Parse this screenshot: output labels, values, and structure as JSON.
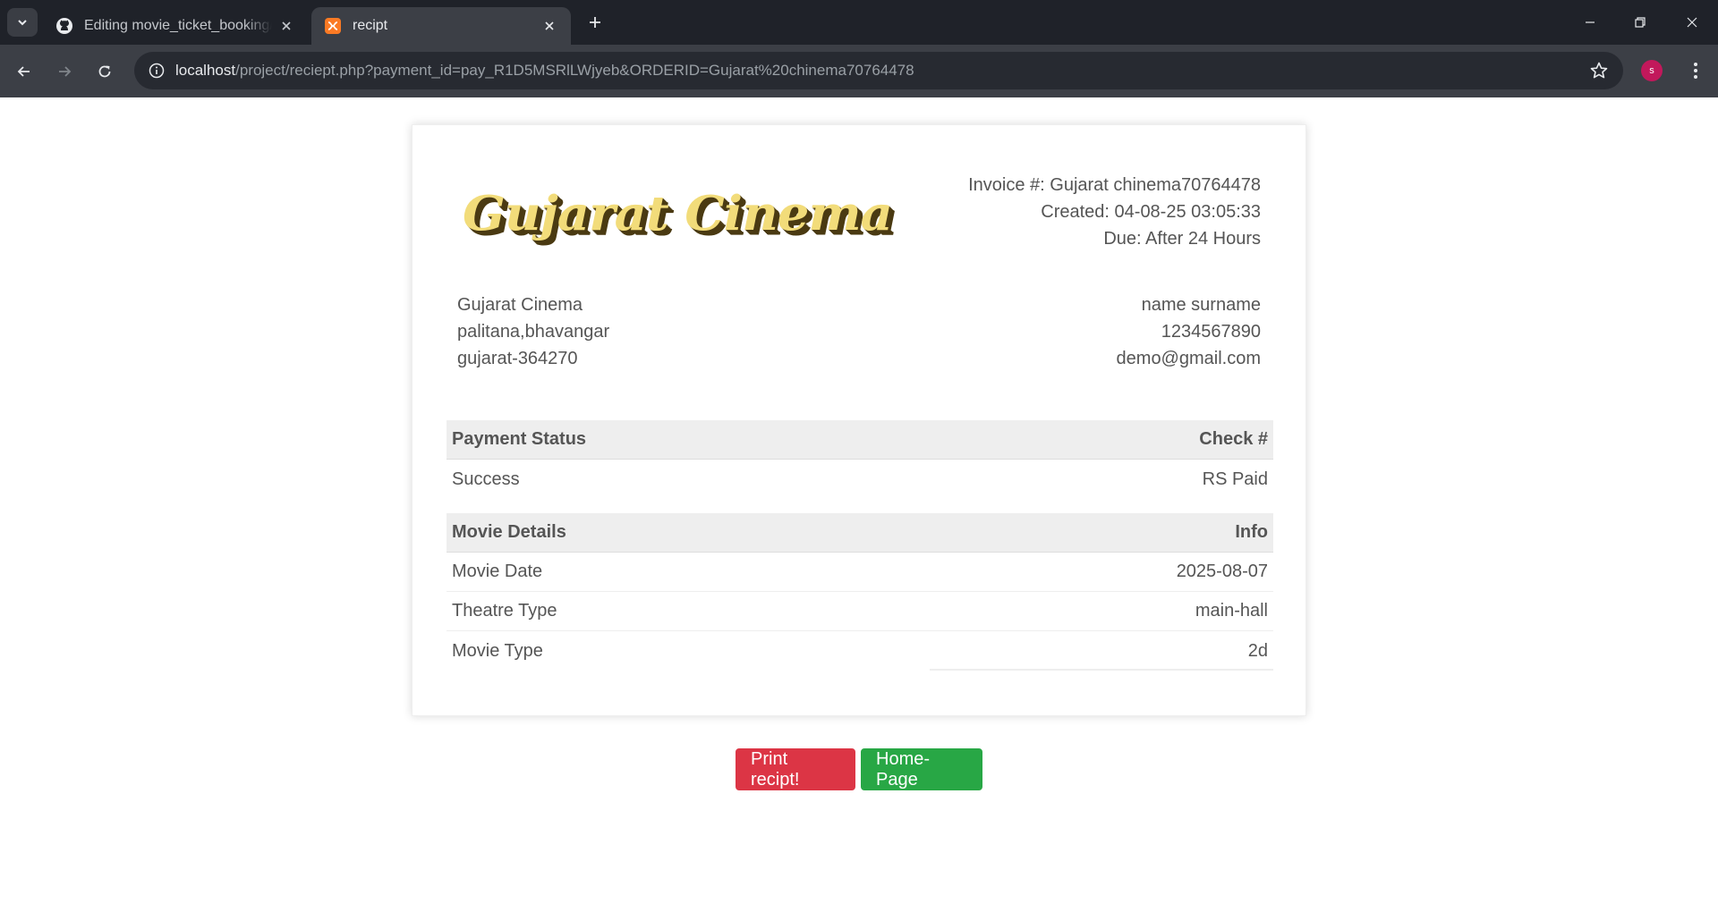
{
  "browser": {
    "tabs": [
      {
        "title": "Editing movie_ticket_booking/R",
        "icon": "github-icon",
        "active": false
      },
      {
        "title": "recipt",
        "icon": "xampp-icon",
        "active": true
      }
    ],
    "url_host": "localhost",
    "url_path": "/project/reciept.php?payment_id=pay_R1D5MSRlLWjyeb&ORDERID=Gujarat%20chinema70764478",
    "profile_initial": "s",
    "profile_color": "#c2185b"
  },
  "invoice": {
    "logo_text": "Gujarat Cinema",
    "meta": {
      "invoice_no": "Invoice #: Gujarat chinema70764478",
      "created": "Created: 04-08-25 03:05:33",
      "due": "Due: After 24 Hours"
    },
    "from": {
      "name": "Gujarat Cinema",
      "address1": "palitana,bhavangar",
      "address2": "gujarat-364270"
    },
    "to": {
      "name": "name surname",
      "phone": "1234567890",
      "email": "demo@gmail.com"
    },
    "payment_table": {
      "header_left": "Payment Status",
      "header_right": "Check #",
      "value_left": "Success",
      "value_right": "RS Paid"
    },
    "movie_table": {
      "header_left": "Movie Details",
      "header_right": "Info",
      "rows": [
        {
          "label": "Movie Date",
          "value": "2025-08-07"
        },
        {
          "label": "Theatre Type",
          "value": "main-hall"
        },
        {
          "label": "Movie Type",
          "value": "2d"
        }
      ]
    }
  },
  "buttons": {
    "print": "Print recipt!",
    "home": "Home-Page"
  },
  "colors": {
    "print_button": "#dc3545",
    "home_button": "#28a745"
  }
}
